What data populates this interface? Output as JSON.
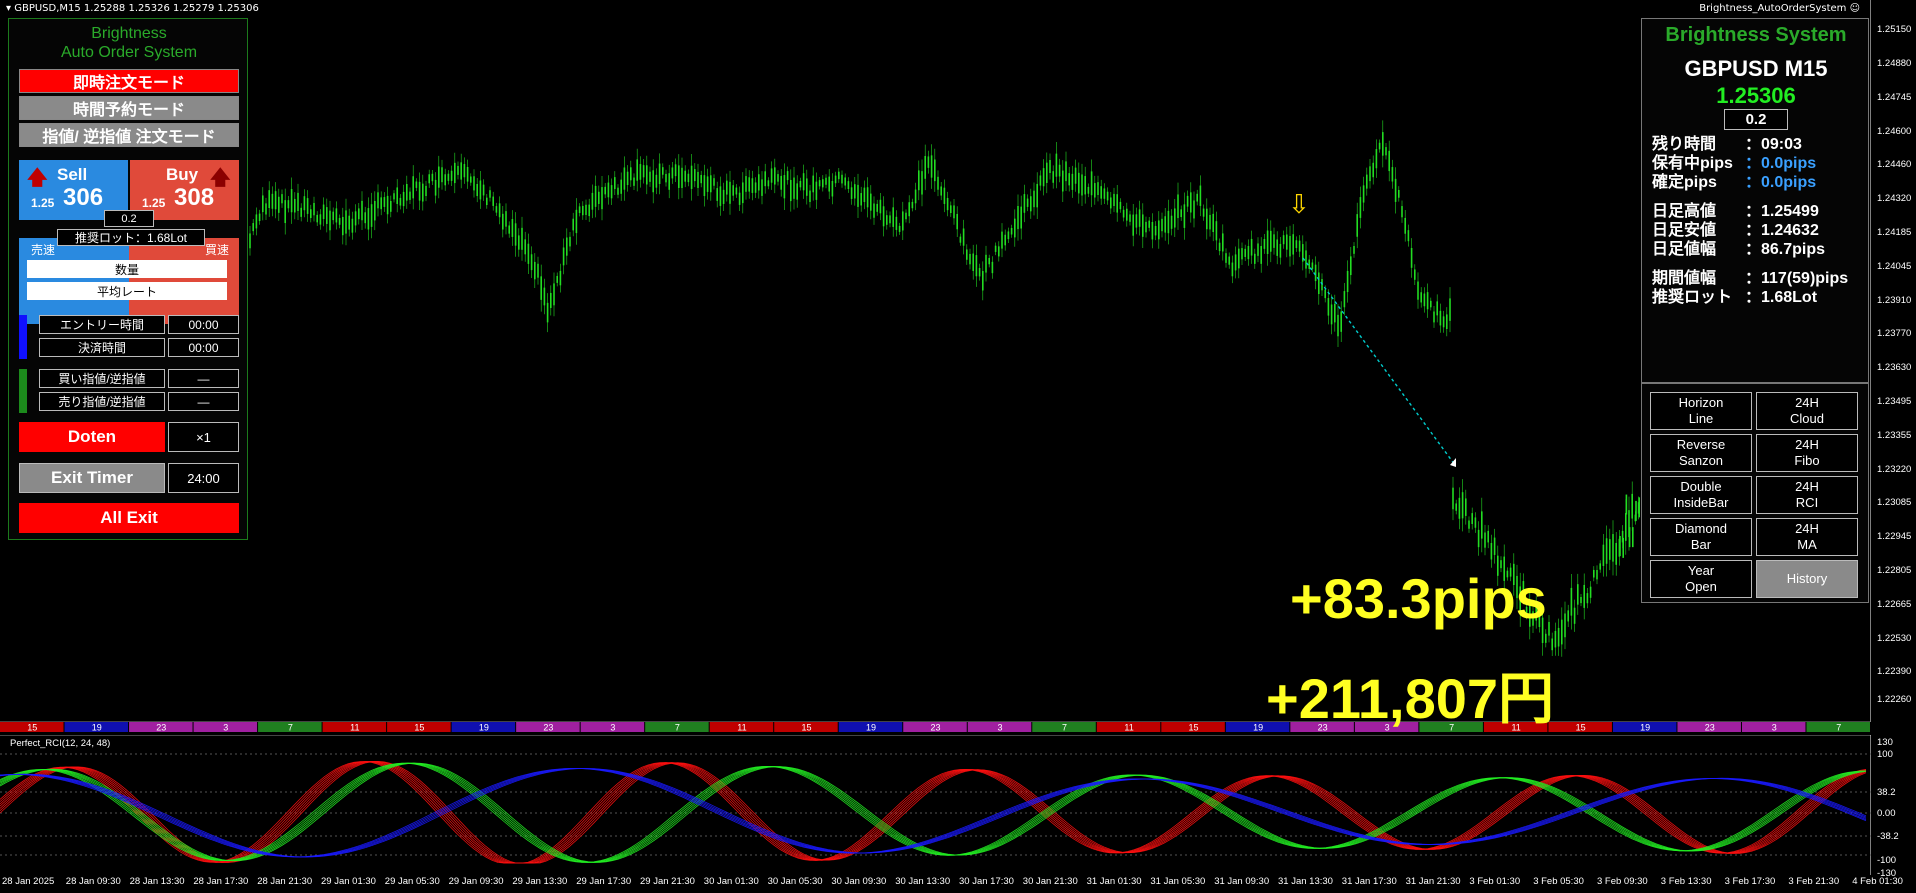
{
  "chart": {
    "title": "GBPUSD,M15  1.25288 1.25326 1.25279 1.25306",
    "ea_name": "Brightness_AutoOrderSystem ☺"
  },
  "price_scale": [
    "1.25150",
    "1.24880",
    "1.24745",
    "1.24600",
    "1.24460",
    "1.24320",
    "1.24185",
    "1.24045",
    "1.23910",
    "1.23770",
    "1.23630",
    "1.23495",
    "1.23355",
    "1.23220",
    "1.23085",
    "1.22945",
    "1.22805",
    "1.22665",
    "1.22530",
    "1.22390",
    "1.22260"
  ],
  "sub_scale": [
    "130",
    "100",
    "38.2",
    "0.00",
    "-38.2",
    "-100",
    "-130"
  ],
  "time_axis": [
    "28 Jan 2025",
    "28 Jan 09:30",
    "28 Jan 13:30",
    "28 Jan 17:30",
    "28 Jan 21:30",
    "29 Jan 01:30",
    "29 Jan 05:30",
    "29 Jan 09:30",
    "29 Jan 13:30",
    "29 Jan 17:30",
    "29 Jan 21:30",
    "30 Jan 01:30",
    "30 Jan 05:30",
    "30 Jan 09:30",
    "30 Jan 13:30",
    "30 Jan 17:30",
    "30 Jan 21:30",
    "31 Jan 01:30",
    "31 Jan 05:30",
    "31 Jan 09:30",
    "31 Jan 13:30",
    "31 Jan 17:30",
    "31 Jan 21:30",
    "3 Feb 01:30",
    "3 Feb 05:30",
    "3 Feb 09:30",
    "3 Feb 13:30",
    "3 Feb 17:30",
    "3 Feb 21:30",
    "4 Feb 01:30"
  ],
  "hour_strip": [
    {
      "label": "15",
      "color": "#c00000"
    },
    {
      "label": "19",
      "color": "#1010b0"
    },
    {
      "label": "23",
      "color": "#a020a0"
    },
    {
      "label": "3",
      "color": "#a020a0"
    },
    {
      "label": "7",
      "color": "#208020"
    },
    {
      "label": "11",
      "color": "#c00000"
    },
    {
      "label": "15",
      "color": "#c00000"
    },
    {
      "label": "19",
      "color": "#1010b0"
    },
    {
      "label": "23",
      "color": "#a020a0"
    },
    {
      "label": "3",
      "color": "#a020a0"
    },
    {
      "label": "7",
      "color": "#208020"
    },
    {
      "label": "11",
      "color": "#c00000"
    },
    {
      "label": "15",
      "color": "#c00000"
    },
    {
      "label": "19",
      "color": "#1010b0"
    },
    {
      "label": "23",
      "color": "#a020a0"
    },
    {
      "label": "3",
      "color": "#a020a0"
    },
    {
      "label": "7",
      "color": "#208020"
    },
    {
      "label": "11",
      "color": "#c00000"
    },
    {
      "label": "15",
      "color": "#c00000"
    },
    {
      "label": "19",
      "color": "#1010b0"
    },
    {
      "label": "23",
      "color": "#a020a0"
    },
    {
      "label": "3",
      "color": "#a020a0"
    },
    {
      "label": "7",
      "color": "#208020"
    },
    {
      "label": "11",
      "color": "#c00000"
    },
    {
      "label": "15",
      "color": "#c00000"
    },
    {
      "label": "19",
      "color": "#1010b0"
    },
    {
      "label": "23",
      "color": "#a020a0"
    },
    {
      "label": "3",
      "color": "#a020a0"
    },
    {
      "label": "7",
      "color": "#208020"
    }
  ],
  "subwindow": {
    "label": "Perfect_RCI(12, 24, 48)"
  },
  "left_panel": {
    "title1": "Brightness",
    "title2": "Auto Order System",
    "mode_instant": "即時注文モード",
    "mode_timed": "時間予約モード",
    "mode_limit": "指値/ 逆指値 注文モード",
    "sell_label": "Sell",
    "sell_prefix": "1.25",
    "sell_price": "306",
    "buy_label": "Buy",
    "buy_prefix": "1.25",
    "buy_price": "308",
    "lot_value": "0.2",
    "recommended_lot": "推奨ロット：1.68Lot",
    "sell_fast": "売速",
    "buy_fast": "買速",
    "quantity": "数量",
    "avg_rate": "平均レート",
    "entry_time_label": "エントリー時間",
    "entry_time_value": "00:00",
    "settle_time_label": "決済時間",
    "settle_time_value": "00:00",
    "buy_limit_label": "買い指値/逆指値",
    "buy_limit_value": "—",
    "sell_limit_label": "売り指値/逆指値",
    "sell_limit_value": "—",
    "doten": "Doten",
    "doten_mult": "×1",
    "exit_timer": "Exit Timer",
    "exit_timer_value": "24:00",
    "all_exit": "All Exit"
  },
  "right_panel": {
    "title": "Brightness System",
    "symbol": "GBPUSD  M15",
    "price": "1.25306",
    "lot": "0.2",
    "rows": [
      {
        "label": "残り時間",
        "value": "：09:03",
        "color": "#ffffff"
      },
      {
        "label": "保有中pips",
        "value": "：0.0pips",
        "color": "#3aa0ff"
      },
      {
        "label": "確定pips",
        "value": "：0.0pips",
        "color": "#3aa0ff"
      },
      {
        "label": "日足高値",
        "value": "：1.25499",
        "color": "#ffffff"
      },
      {
        "label": "日足安値",
        "value": "：1.24632",
        "color": "#ffffff"
      },
      {
        "label": "日足値幅",
        "value": "：86.7pips",
        "color": "#ffffff"
      },
      {
        "label": "期間値幅",
        "value": "：117(59)pips",
        "color": "#ffffff"
      },
      {
        "label": "推奨ロット",
        "value": "：1.68Lot",
        "color": "#ffffff"
      }
    ],
    "arrow_color": "#00d8ff"
  },
  "grid_buttons": [
    [
      "Horizon\nLine",
      "24H\nCloud"
    ],
    [
      "Reverse\nSanzon",
      "24H\nFibo"
    ],
    [
      "Double\nInsideBar",
      "24H\nRCI"
    ],
    [
      "Diamond\nBar",
      "24H\nMA"
    ],
    [
      "Year\nOpen",
      "History"
    ]
  ],
  "overlay": {
    "pips": "+83.3pips",
    "yen": "+211,807円"
  },
  "colors": {
    "candle": "#22dd22",
    "panel_green": "#2aaa2a",
    "sell_blue": "#2a8ae0",
    "buy_red": "#e04a3a",
    "alert_red": "#ff0000",
    "profit_yellow": "#ffff22",
    "trend_line": "#00cccc"
  }
}
